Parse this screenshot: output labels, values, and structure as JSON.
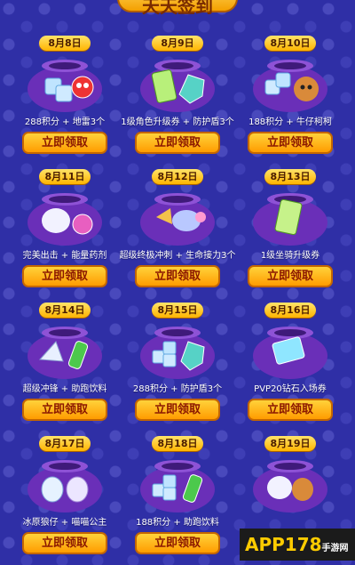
{
  "header": {
    "title": "天天签到"
  },
  "button_label": "立即领取",
  "cards": [
    {
      "date": "8月8日",
      "reward": "288积分 + 地雷3个"
    },
    {
      "date": "8月9日",
      "reward": "1级角色升级券 + 防护盾3个"
    },
    {
      "date": "8月10日",
      "reward": "188积分 + 牛仔柯柯"
    },
    {
      "date": "8月11日",
      "reward": "完美出击 + 能量药剂"
    },
    {
      "date": "8月12日",
      "reward": "超级终极冲刺 + 生命接力3个"
    },
    {
      "date": "8月13日",
      "reward": "1级坐骑升级券"
    },
    {
      "date": "8月14日",
      "reward": "超级冲锋 + 助跑饮料"
    },
    {
      "date": "8月15日",
      "reward": "288积分 + 防护盾3个"
    },
    {
      "date": "8月16日",
      "reward": "PVP20钻石入场券"
    },
    {
      "date": "8月17日",
      "reward": "冰原狼仔 + 喵喵公主"
    },
    {
      "date": "8月18日",
      "reward": "188积分 + 助跑饮料"
    },
    {
      "date": "8月19日",
      "reward": ""
    }
  ],
  "watermark": {
    "brand": "APP178",
    "suffix": "手游网"
  }
}
